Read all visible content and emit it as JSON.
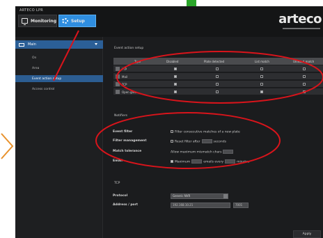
{
  "app": {
    "title": "ARTECO LPR",
    "logo": "arteco"
  },
  "tabs": {
    "monitoring": "Monitoring",
    "setup": "Setup"
  },
  "sidebar": {
    "header": "Main",
    "items": [
      "On",
      "Area",
      "Event action setup",
      "Access control"
    ]
  },
  "event_setup": {
    "title": "Event action setup",
    "columns": [
      "Type",
      "Disabled",
      "Plate detected",
      "List match",
      "Unlisted match"
    ],
    "rows": [
      {
        "label": "FTP",
        "checks": [
          true,
          false,
          false,
          false
        ]
      },
      {
        "label": "Mail",
        "checks": [
          true,
          false,
          false,
          false
        ]
      },
      {
        "label": "TCP",
        "checks": [
          true,
          false,
          false,
          false
        ]
      },
      {
        "label": "Open gate",
        "checks": [
          true,
          false,
          true,
          false
        ]
      }
    ]
  },
  "notifications": {
    "title": "Notifiers",
    "event_filter": {
      "label": "Event filter",
      "text": "Filter consecutive matches of a new plate"
    },
    "filter_management": {
      "label": "Filter management",
      "before": "Reset filter after",
      "after": "seconds"
    },
    "match_tolerance": {
      "label": "Match tolerance",
      "text": "Allow maximum mismatch chars"
    },
    "email": {
      "label": "Email",
      "maximum": "Maximum",
      "emails_every": "emails every",
      "minutes": "minutes"
    }
  },
  "tcp": {
    "title": "TCP",
    "protocol": {
      "label": "Protocol",
      "value": "Generic NVR"
    },
    "address": {
      "label": "Address / port",
      "ip": "192.168.10.21",
      "port": "7001"
    }
  },
  "apply_label": "Apply",
  "colors": {
    "accent": "#2f8ee0",
    "selection": "#2c5d92",
    "annotation": "#d9141b",
    "marker": "#e8912c"
  }
}
